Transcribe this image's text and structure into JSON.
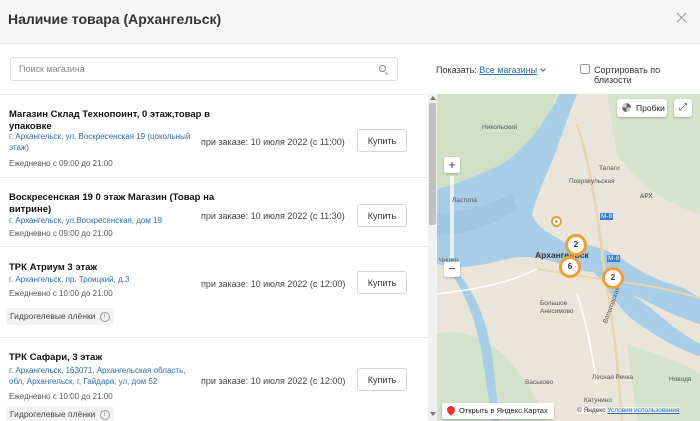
{
  "modal": {
    "title": "Наличие товара (Архангельск)"
  },
  "search": {
    "placeholder": "Поиск магазина",
    "value": ""
  },
  "filters": {
    "show_prefix": "Показать:",
    "show_value": "Все магазины",
    "sort_label": "Сортировать по близости",
    "sort_checked": false
  },
  "stores": [
    {
      "name": "Магазин Склад Технопоинт, 0 этаж,товар в упаковке",
      "address": "г. Архангельск, ул. Воскресенская 19 (цокольный этаж)",
      "hours": "Ежедневно с 09:00 до 21:00",
      "availability": "при заказе: 10 июля 2022 (с 11:00)",
      "buy_label": "Купить",
      "feature": ""
    },
    {
      "name": "Воскресенская 19 0 этаж Магазин (Товар на витрине)",
      "address": "г. Архангельск, ул.Воскресенская, дом 19",
      "hours": "Ежедневно с 09:00 до 21:00",
      "availability": "при заказе: 10 июля 2022 (с 11:30)",
      "buy_label": "Купить",
      "feature": ""
    },
    {
      "name": "ТРК Атриум 3 этаж",
      "address": "г. Архангельск, пр. Троицкий, д.3",
      "hours": "Ежедневно с 10:00 до 21:00",
      "availability": "при заказе: 10 июля 2022 (с 12:00)",
      "buy_label": "Купить",
      "feature": "Гидрогелевые плёнки"
    },
    {
      "name": "ТРК Сафари, 3 этаж",
      "address": "г. Архангельск, 163071, Архангельская область, обл, Архангельск, г, Гайдара, ул, дом 52",
      "hours": "Ежедневно с 10:00 до 21:00",
      "availability": "при заказе: 10 июля 2022 (с 12:00)",
      "buy_label": "Купить",
      "feature": "Гидрогелевые плёнки"
    }
  ],
  "map": {
    "traffic_label": "Пробки",
    "zoom_in": "+",
    "zoom_out": "−",
    "expand_icon": "⤢",
    "open_yandex_label": "Открыть в Яндекс.Картах",
    "copyright_prefix": "© Яндекс",
    "terms_link": "Условия использования",
    "labels": {
      "nikolsky": "Никольский",
      "talagi": "Талаги",
      "povrakulskaya": "Повракульская",
      "lastola": "Ластола",
      "chishki": "Чишки",
      "city": "Архангельск",
      "bolshoe_anisimovo": "Большое Анисимово",
      "vaskovo": "Васьково",
      "lesnaya_rechka": "Лесная Речка",
      "katunino": "Катунино",
      "novodv": "Новодв",
      "road_m8_a": "М-8",
      "road_m8_b": "М-8",
      "road_arh": "АРХ",
      "road_vologod": "Вологодская"
    },
    "clusters": [
      "2",
      "6",
      "2"
    ],
    "accent_color": "#f0a030"
  }
}
